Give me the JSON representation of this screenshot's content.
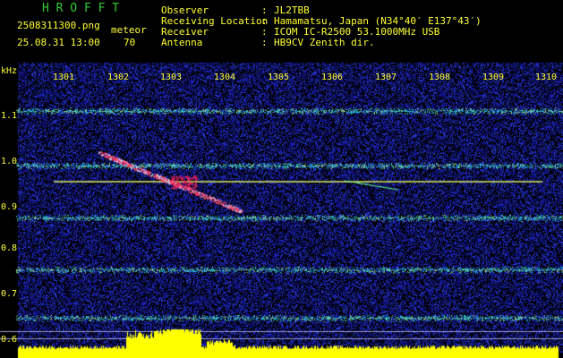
{
  "app": {
    "title": "H R O F F T",
    "filename": "2508311300.png",
    "datetime": "25.08.31 13:00",
    "mode_label": "meteor",
    "count": "70"
  },
  "station": [
    {
      "key": "Observer",
      "value": "JL2TBB"
    },
    {
      "key": "Receiving Location",
      "value": "Hamamatsu, Japan (N34°40′ E137°43′)"
    },
    {
      "key": "Receiver",
      "value": "ICOM IC-R2500 53.1000MHz USB"
    },
    {
      "key": "Antenna",
      "value": "HB9CV Zenith dir."
    }
  ],
  "axis": {
    "unit": "kHz",
    "x_ticks": [
      "1301",
      "1302",
      "1303",
      "1304",
      "1305",
      "1306",
      "1307",
      "1308",
      "1309",
      "1310"
    ],
    "y_ticks": [
      "1.1",
      "1.0",
      "0.9",
      "0.8",
      "0.7",
      "0.6"
    ]
  },
  "colors": {
    "background": "#000000",
    "text": "#ffff33",
    "title": "#33cc33",
    "noise": "#1a1a8c",
    "signal": "#ffff66",
    "meteor": "#ff3355",
    "baseline": "#ffff00"
  }
}
